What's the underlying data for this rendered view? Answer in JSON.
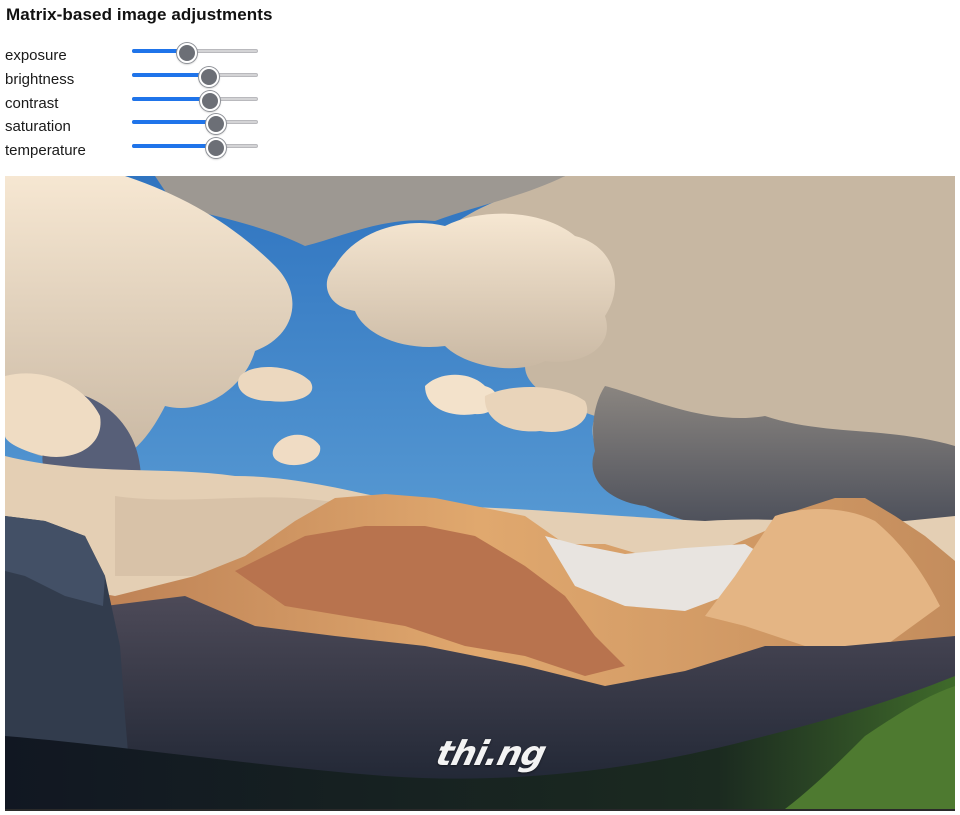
{
  "page": {
    "title": "Matrix-based image adjustments"
  },
  "controls": [
    {
      "label": "exposure",
      "value": 0.43
    },
    {
      "label": "brightness",
      "value": 0.6
    },
    {
      "label": "contrast",
      "value": 0.61
    },
    {
      "label": "saturation",
      "value": 0.66
    },
    {
      "label": "temperature",
      "value": 0.66
    }
  ],
  "image": {
    "watermark": "thi.ng"
  },
  "colors": {
    "slider_fill": "#1f74ea",
    "slider_track": "#d4d4d6",
    "slider_thumb": "#6c6f76",
    "sky": "#3c82c6"
  }
}
